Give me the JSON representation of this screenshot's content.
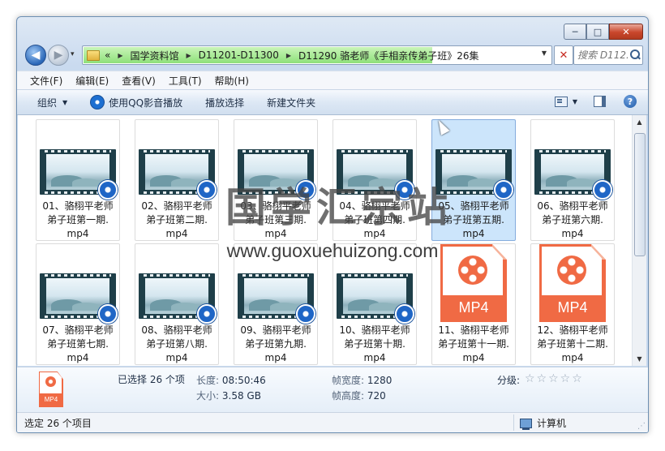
{
  "window": {
    "caption": {
      "minimize": "─",
      "maximize": "□",
      "close": "✕"
    }
  },
  "nav": {
    "back_glyph": "◀",
    "forward_glyph": "▶",
    "history_glyph": "▾",
    "address": {
      "overflow": "«",
      "crumbs": [
        "国学资料馆",
        "D11201-D11300",
        "D11290 骆老师《手相亲传弟子班》26集"
      ],
      "separator": "▶",
      "dropdown_glyph": "▼",
      "refresh_glyph": "✕",
      "fill_color": "#8ee07a"
    },
    "search": {
      "placeholder": "搜索 D112..."
    }
  },
  "menubar": {
    "items": [
      "文件(F)",
      "编辑(E)",
      "查看(V)",
      "工具(T)",
      "帮助(H)"
    ]
  },
  "toolbar": {
    "organize": "组织",
    "caret": "▼",
    "qq_play": "使用QQ影音播放",
    "play_selection": "播放选择",
    "new_folder": "新建文件夹",
    "help_glyph": "?"
  },
  "files": [
    {
      "name": "01、骆栩平老师弟子班第一期.mp4",
      "line1": "01、骆栩平老师",
      "line2": "弟子班第一期.",
      "line3": "mp4",
      "thumb": "video",
      "selected": false
    },
    {
      "name": "02、骆栩平老师弟子班第二期.mp4",
      "line1": "02、骆栩平老师",
      "line2": "弟子班第二期.",
      "line3": "mp4",
      "thumb": "video",
      "selected": false
    },
    {
      "name": "03、骆栩平老师弟子班第三期.mp4",
      "line1": "03、骆栩平老师",
      "line2": "弟子班第三期.",
      "line3": "mp4",
      "thumb": "video",
      "selected": false
    },
    {
      "name": "04、骆栩平老师弟子班第四期.mp4",
      "line1": "04、骆栩平老师",
      "line2": "弟子班第四期.",
      "line3": "mp4",
      "thumb": "video",
      "selected": false
    },
    {
      "name": "05、骆栩平老师弟子班第五期.mp4",
      "line1": "05、骆栩平老师",
      "line2": "弟子班第五期.",
      "line3": "mp4",
      "thumb": "video",
      "selected": true
    },
    {
      "name": "06、骆栩平老师弟子班第六期.mp4",
      "line1": "06、骆栩平老师",
      "line2": "弟子班第六期.",
      "line3": "mp4",
      "thumb": "video",
      "selected": false
    },
    {
      "name": "07、骆栩平老师弟子班第七期.mp4",
      "line1": "07、骆栩平老师",
      "line2": "弟子班第七期.",
      "line3": "mp4",
      "thumb": "video",
      "selected": false
    },
    {
      "name": "08、骆栩平老师弟子班第八期.mp4",
      "line1": "08、骆栩平老师",
      "line2": "弟子班第八期.",
      "line3": "mp4",
      "thumb": "video",
      "selected": false
    },
    {
      "name": "09、骆栩平老师弟子班第九期.mp4",
      "line1": "09、骆栩平老师",
      "line2": "弟子班第九期.",
      "line3": "mp4",
      "thumb": "video",
      "selected": false
    },
    {
      "name": "10、骆栩平老师弟子班第十期.mp4",
      "line1": "10、骆栩平老师",
      "line2": "弟子班第十期.",
      "line3": "mp4",
      "thumb": "video",
      "selected": false
    },
    {
      "name": "11、骆栩平老师弟子班第十一期.mp4",
      "line1": "11、骆栩平老师",
      "line2": "弟子班第十一期.",
      "line3": "mp4",
      "thumb": "mp4",
      "selected": false
    },
    {
      "name": "12、骆栩平老师弟子班第十二期.mp4",
      "line1": "12、骆栩平老师",
      "line2": "弟子班第十二期.",
      "line3": "mp4",
      "thumb": "mp4",
      "selected": false
    }
  ],
  "mp4_label": "MP4",
  "details": {
    "selected": "已选择 26 个项",
    "length_label": "长度:",
    "length_value": "08:50:46",
    "size_label": "大小:",
    "size_value": "3.58 GB",
    "frame_width_label": "帧宽度:",
    "frame_width_value": "1280",
    "frame_height_label": "帧高度:",
    "frame_height_value": "720",
    "rating_label": "分级:",
    "rating_stars": "☆☆☆☆☆",
    "rating_value": 0
  },
  "statusbar": {
    "left": "选定 26 个项目",
    "right": "计算机"
  },
  "watermark": {
    "cn": "国学汇宗站",
    "url": "www.guoxuehuizong.com"
  },
  "colors": {
    "selection": "#cce5fb",
    "mp4_orange": "#f06a44",
    "close_red": "#c9462b"
  }
}
